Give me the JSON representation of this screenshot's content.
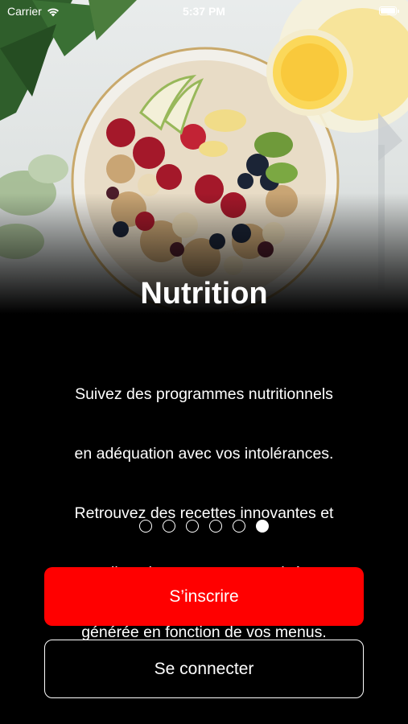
{
  "status_bar": {
    "carrier": "Carrier",
    "time": "5:37 PM",
    "battery_level": 1.0
  },
  "onboarding": {
    "hero_image": "fruit-bowl-with-lemon-drink",
    "title": "Nutrition",
    "description_lines": [
      "Suivez des programmes nutritionnels",
      "en adéquation avec vos intolérances.",
      "Retrouvez des recettes innovantes et",
      "une liste de courses automatisée et",
      "générée en fonction de vos menus."
    ],
    "page_count": 6,
    "current_page": 6
  },
  "actions": {
    "signup_label": "S’inscrire",
    "login_label": "Se connecter"
  },
  "colors": {
    "accent": "#ff0000",
    "background": "#000000",
    "text": "#ffffff"
  }
}
